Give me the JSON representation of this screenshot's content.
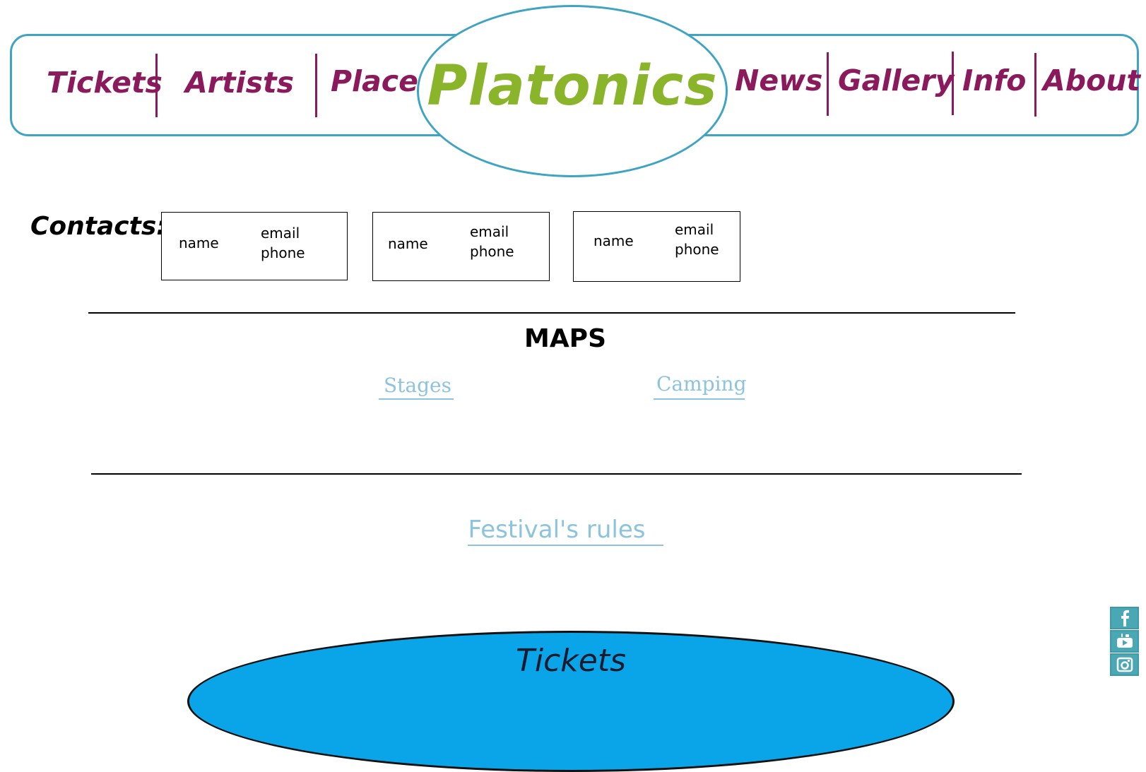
{
  "header": {
    "logo": "Platonics",
    "nav_left": [
      "Tickets",
      "Artists",
      "Place"
    ],
    "nav_right": [
      "News",
      "Gallery",
      "Info",
      "About"
    ]
  },
  "contacts": {
    "label": "Contacts:",
    "cards": [
      {
        "name": "name",
        "email": "email",
        "phone": "phone"
      },
      {
        "name": "name",
        "email": "email",
        "phone": "phone"
      },
      {
        "name": "name",
        "email": "email",
        "phone": "phone"
      }
    ]
  },
  "maps": {
    "title": "MAPS",
    "links": [
      "Stages",
      "Camping"
    ]
  },
  "rules": {
    "label": "Festival's rules"
  },
  "tickets_button": {
    "label": "Tickets"
  },
  "social": {
    "icons": [
      "facebook-icon",
      "youtube-icon",
      "instagram-icon"
    ]
  },
  "colors": {
    "nav_text": "#8a1a5c",
    "logo": "#8ab52a",
    "border": "#3ea4c2",
    "link": "#8cc3dd",
    "tickets_fill": "#0aa5e8"
  }
}
